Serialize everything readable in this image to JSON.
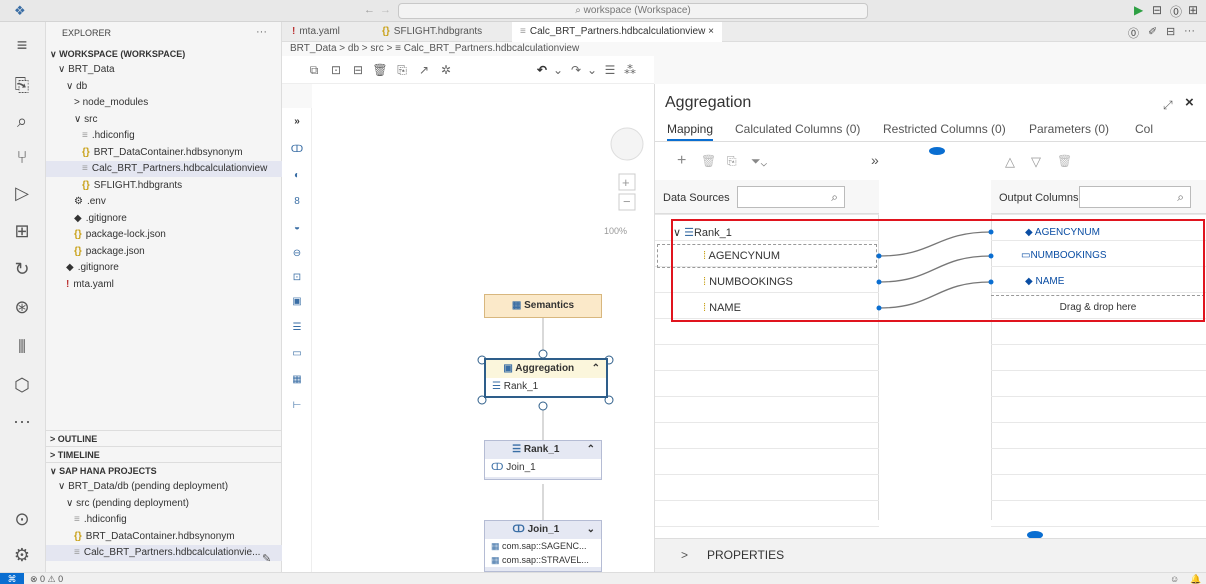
{
  "titlebar": {
    "search": "workspace (Workspace)"
  },
  "explorer": {
    "header": "EXPLORER",
    "more": "···",
    "workspace": "WORKSPACE (WORKSPACE)",
    "tree": [
      {
        "label": "BRT_Data",
        "indent": 1,
        "icon": "",
        "chev": "∨"
      },
      {
        "label": "db",
        "indent": 2,
        "icon": "",
        "chev": "∨"
      },
      {
        "label": "node_modules",
        "indent": 3,
        "icon": "",
        "chev": ">"
      },
      {
        "label": "src",
        "indent": 3,
        "icon": "",
        "chev": "∨"
      },
      {
        "label": ".hdiconfig",
        "indent": 4,
        "icon": "≡",
        "chev": ""
      },
      {
        "label": "BRT_DataContainer.hdbsynonym",
        "indent": 4,
        "icon": "{}",
        "chev": ""
      },
      {
        "label": "Calc_BRT_Partners.hdbcalculationview",
        "indent": 4,
        "icon": "≡",
        "chev": ""
      },
      {
        "label": "SFLIGHT.hdbgrants",
        "indent": 4,
        "icon": "{}",
        "chev": ""
      },
      {
        "label": ".env",
        "indent": 3,
        "icon": "⚙",
        "chev": ""
      },
      {
        "label": ".gitignore",
        "indent": 3,
        "icon": "◆",
        "chev": ""
      },
      {
        "label": "package-lock.json",
        "indent": 3,
        "icon": "{}",
        "chev": ""
      },
      {
        "label": "package.json",
        "indent": 3,
        "icon": "{}",
        "chev": ""
      },
      {
        "label": ".gitignore",
        "indent": 2,
        "icon": "◆",
        "chev": ""
      },
      {
        "label": "mta.yaml",
        "indent": 2,
        "icon": "!",
        "chev": ""
      }
    ],
    "outline": "OUTLINE",
    "timeline": "TIMELINE",
    "hana": "SAP HANA PROJECTS",
    "hana_tree": [
      {
        "label": "BRT_Data/db  (pending deployment)",
        "indent": 1,
        "icon": "",
        "chev": "∨"
      },
      {
        "label": "src  (pending deployment)",
        "indent": 2,
        "icon": "",
        "chev": "∨"
      },
      {
        "label": ".hdiconfig",
        "indent": 3,
        "icon": "≡",
        "chev": ""
      },
      {
        "label": "BRT_DataContainer.hdbsynonym",
        "indent": 3,
        "icon": "{}",
        "chev": ""
      },
      {
        "label": "Calc_BRT_Partners.hdbcalculationvie...",
        "indent": 3,
        "icon": "≡",
        "chev": ""
      }
    ]
  },
  "tabs": [
    {
      "icon": "!",
      "label": "mta.yaml"
    },
    {
      "icon": "{}",
      "label": "SFLIGHT.hdbgrants"
    },
    {
      "icon": "≡",
      "label": "Calc_BRT_Partners.hdbcalculationview",
      "close": "×"
    }
  ],
  "breadcrumb": "BRT_Data > db > src > ≡ Calc_BRT_Partners.hdbcalculationview",
  "canvas": {
    "zoom": "100%",
    "nodes": {
      "semantics": "Semantics",
      "aggregation": "Aggregation",
      "agg_child": "Rank_1",
      "rank": "Rank_1",
      "rank_child": "Join_1",
      "join": "Join_1",
      "join_child1": "com.sap::SAGENC...",
      "join_child2": "com.sap::STRAVEL..."
    }
  },
  "panel": {
    "title": "Aggregation",
    "tabs": [
      "Mapping",
      "Calculated Columns (0)",
      "Restricted Columns (0)",
      "Parameters (0)",
      "Col"
    ],
    "data_sources_label": "Data Sources",
    "output_columns_label": "Output Columns",
    "source_root": "Rank_1",
    "source_fields": [
      "AGENCYNUM",
      "NUMBOOKINGS",
      "NAME"
    ],
    "output_fields": [
      "AGENCYNUM",
      "NUMBOOKINGS",
      "NAME"
    ],
    "drop_hint": "Drag & drop here",
    "properties": "PROPERTIES",
    "highlight_color": "#e0141e"
  },
  "status": "⊗ 0 ⚠ 0"
}
